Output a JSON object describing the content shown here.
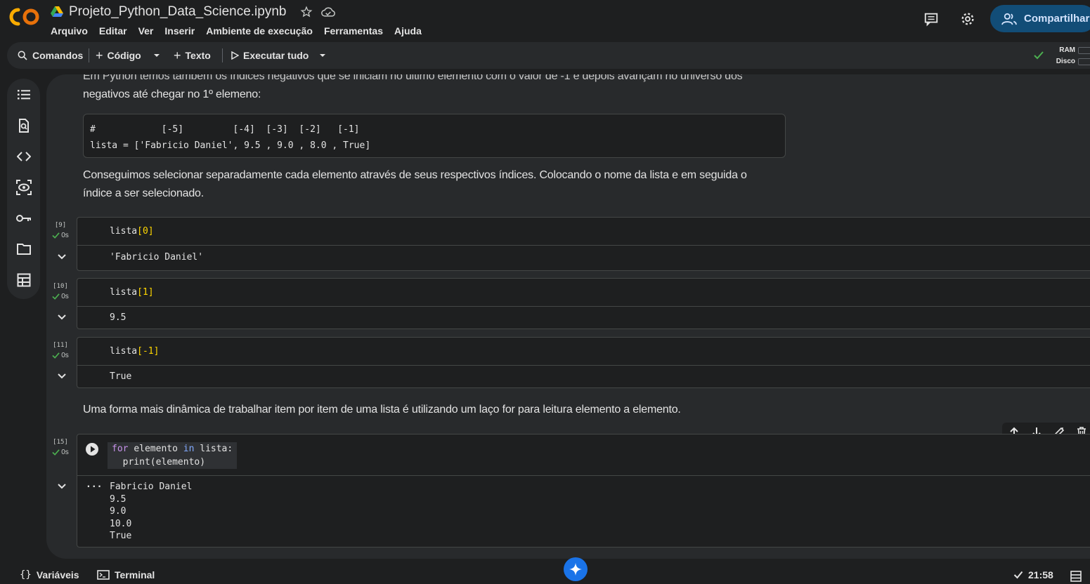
{
  "header": {
    "title": "Projeto_Python_Data_Science.ipynb",
    "menu": [
      "Arquivo",
      "Editar",
      "Ver",
      "Inserir",
      "Ambiente de execução",
      "Ferramentas",
      "Ajuda"
    ],
    "share_label": "Compartilhar"
  },
  "toolbar": {
    "commands": "Comandos",
    "code": "Código",
    "text": "Texto",
    "run_all": "Executar tudo",
    "ram": "RAM",
    "disk": "Disco"
  },
  "notebook": {
    "para_top_partial": "Em Python temos também os índices negativos que se iniciam no último elemento com o valor de -1 e depois avançam no universo dos",
    "para_top": "negativos até chegar no 1º elemeno:",
    "code_line1": "#            [-5]         [-4]  [-3]  [-2]   [-1]",
    "code_line2": "lista = ['Fabricio Daniel', 9.5 , 9.0 , 8.0 , True]",
    "para_mid_1": "Conseguimos selecionar separadamente cada elemento através de seus respectivos índices. Colocando o nome da lista e em seguida o",
    "para_mid_2": "índice a ser selecionado.",
    "para_loop": "Uma forma mais dinâmica de trabalhar item por item de uma lista é utilizando um laço for para leitura elemento a elemento.",
    "cells": [
      {
        "count": "[9]",
        "status": "0s",
        "code_name": "lista",
        "code_index": "[0]",
        "output": "'Fabricio Daniel'"
      },
      {
        "count": "[10]",
        "status": "0s",
        "code_name": "lista",
        "code_index": "[1]",
        "output": "9.5"
      },
      {
        "count": "[11]",
        "status": "0s",
        "code_name": "lista",
        "code_index": "[-1]",
        "output": "True"
      }
    ],
    "loop_cell": {
      "count": "[15]",
      "status": "0s",
      "kw_for": "for",
      "var": "elemento",
      "kw_in": "in",
      "iter": "lista:",
      "print_call": "print(elemento)",
      "outputs": [
        "Fabricio Daniel",
        "9.5",
        "9.0",
        "10.0",
        "True"
      ],
      "more": "..."
    }
  },
  "bottombar": {
    "variables": "Variáveis",
    "terminal": "Terminal",
    "time": "21:58"
  },
  "colors": {
    "accent": "#124d77",
    "gemini": "#1a73e8",
    "success": "#4caf50",
    "logo": "#f9ab00"
  }
}
